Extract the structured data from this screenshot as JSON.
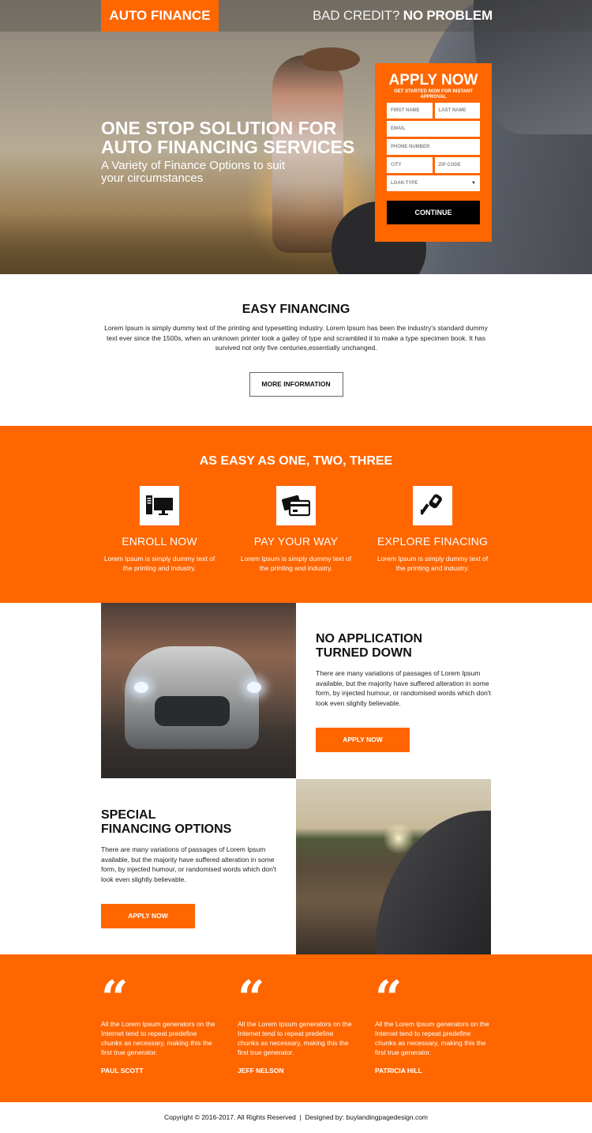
{
  "header": {
    "logo": "AUTO FINANCE",
    "tagline_light": "BAD CREDIT? ",
    "tagline_bold": "NO PROBLEM"
  },
  "hero": {
    "title": "ONE STOP SOLUTION FOR AUTO FINANCING SERVICES",
    "subtitle": "A Variety of Finance Options to suit your circumstances"
  },
  "form": {
    "title": "APPLY NOW",
    "subtitle": "GET STARTED NOW FOR INSTANT APPROVAL",
    "fields": {
      "first_name": "FIRST NAME",
      "last_name": "LAST NAME",
      "email": "EMAIL",
      "phone": "PHONE NUMBER",
      "city": "CITY",
      "zip": "ZIP CODE",
      "loan_type": "LOAN TYPE"
    },
    "submit": "CONTINUE"
  },
  "easy": {
    "title": "EASY FINANCING",
    "body": "Lorem Ipsum is simply dummy text of the printing and typesetting industry. Lorem Ipsum has been the industry's standard dummy text ever since the 1500s, when an unknown printer took a galley of type and scrambled it to make a type specimen book. It has survived not only five centuries,essentially unchanged.",
    "button": "MORE INFORMATION"
  },
  "steps": {
    "title": "AS EASY AS ONE, TWO, THREE",
    "items": [
      {
        "icon": "computer-icon",
        "title": "ENROLL NOW",
        "body": "Lorem Ipsum is simply dummy text of the printing and industry."
      },
      {
        "icon": "credit-card-icon",
        "title": "PAY YOUR WAY",
        "body": "Lorem Ipsum is simply dummy text of the printing and industry."
      },
      {
        "icon": "car-key-icon",
        "title": "EXPLORE FINACING",
        "body": "Lorem Ipsum is simply dummy text of the printing and industry."
      }
    ]
  },
  "features": [
    {
      "title_line1": "NO APPLICATION",
      "title_line2": "TURNED DOWN",
      "body": "There are many variations of passages of Lorem Ipsum available, but the majority have suffered alteration in some form, by injected humour, or randomised words which don't look even slightly believable.",
      "button": "APPLY NOW"
    },
    {
      "title_line1": "SPECIAL",
      "title_line2": "FINANCING OPTIONS",
      "body": "There are many variations of passages of Lorem Ipsum available, but the majority have suffered alteration in some form, by injected humour, or randomised words which don't look even slightly believable.",
      "button": "APPLY NOW"
    }
  ],
  "testimonials": [
    {
      "quote_mark": "“",
      "text": "All the Lorem Ipsum generators on the Internet tend to repeat predefine chunks as necessary, making this the first true generator.",
      "name": "PAUL SCOTT"
    },
    {
      "quote_mark": "“",
      "text": "All the Lorem Ipsum generators on the Internet tend to repeat predefine chunks as necessary, making this the first true generator.",
      "name": "JEFF NELSON"
    },
    {
      "quote_mark": "“",
      "text": "All the Lorem Ipsum generators on the Internet tend to repeat predefine chunks as necessary, making this the first true generator.",
      "name": "PATRICIA HILL"
    }
  ],
  "footer": {
    "text": "Copyright © 2016-2017. All Rights Reserved  |  Designed by: buylandingpagedesign.com"
  },
  "colors": {
    "accent": "#ff6600",
    "button_dark": "#000000"
  }
}
